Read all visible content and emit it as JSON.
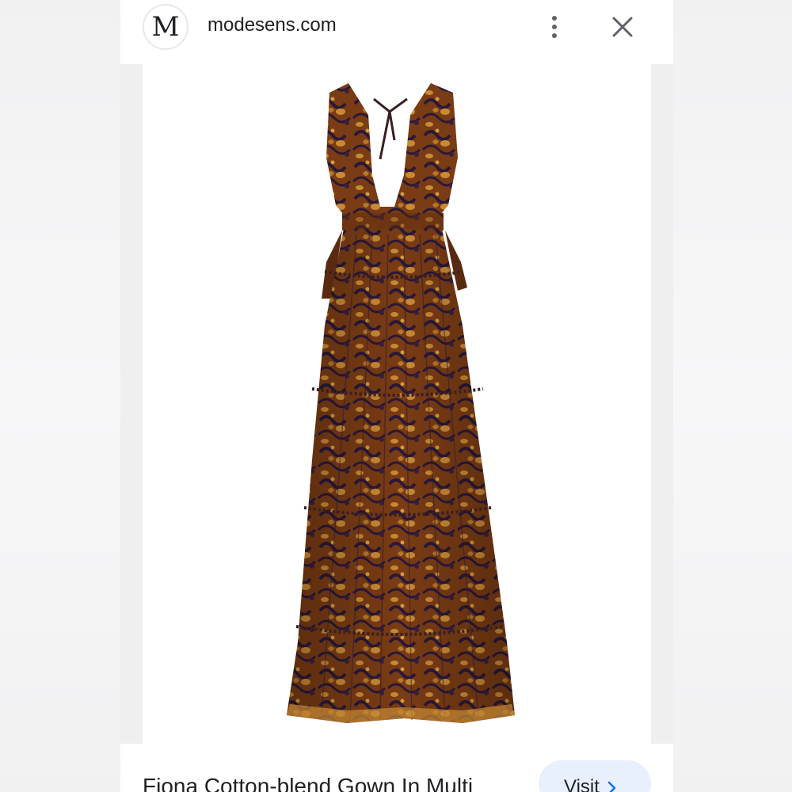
{
  "header": {
    "site_initial": "M",
    "site_name": "modesens.com",
    "more_icon": "more-vert-icon",
    "close_icon": "close-icon"
  },
  "image": {
    "alt": "Fiona Cotton-blend Gown In Multi",
    "palette": {
      "dark": "#2a1838",
      "mid": "#7a3c14",
      "light": "#b9772a",
      "gold": "#d69a3c"
    }
  },
  "caption": {
    "title": "Fiona Cotton-blend Gown In Multi",
    "visit_label": "Visit",
    "visit_icon": "chevron-right-icon"
  },
  "colors": {
    "accent_blue": "#1a73e8",
    "visit_bg": "#e8f0fe",
    "text": "#202124"
  }
}
